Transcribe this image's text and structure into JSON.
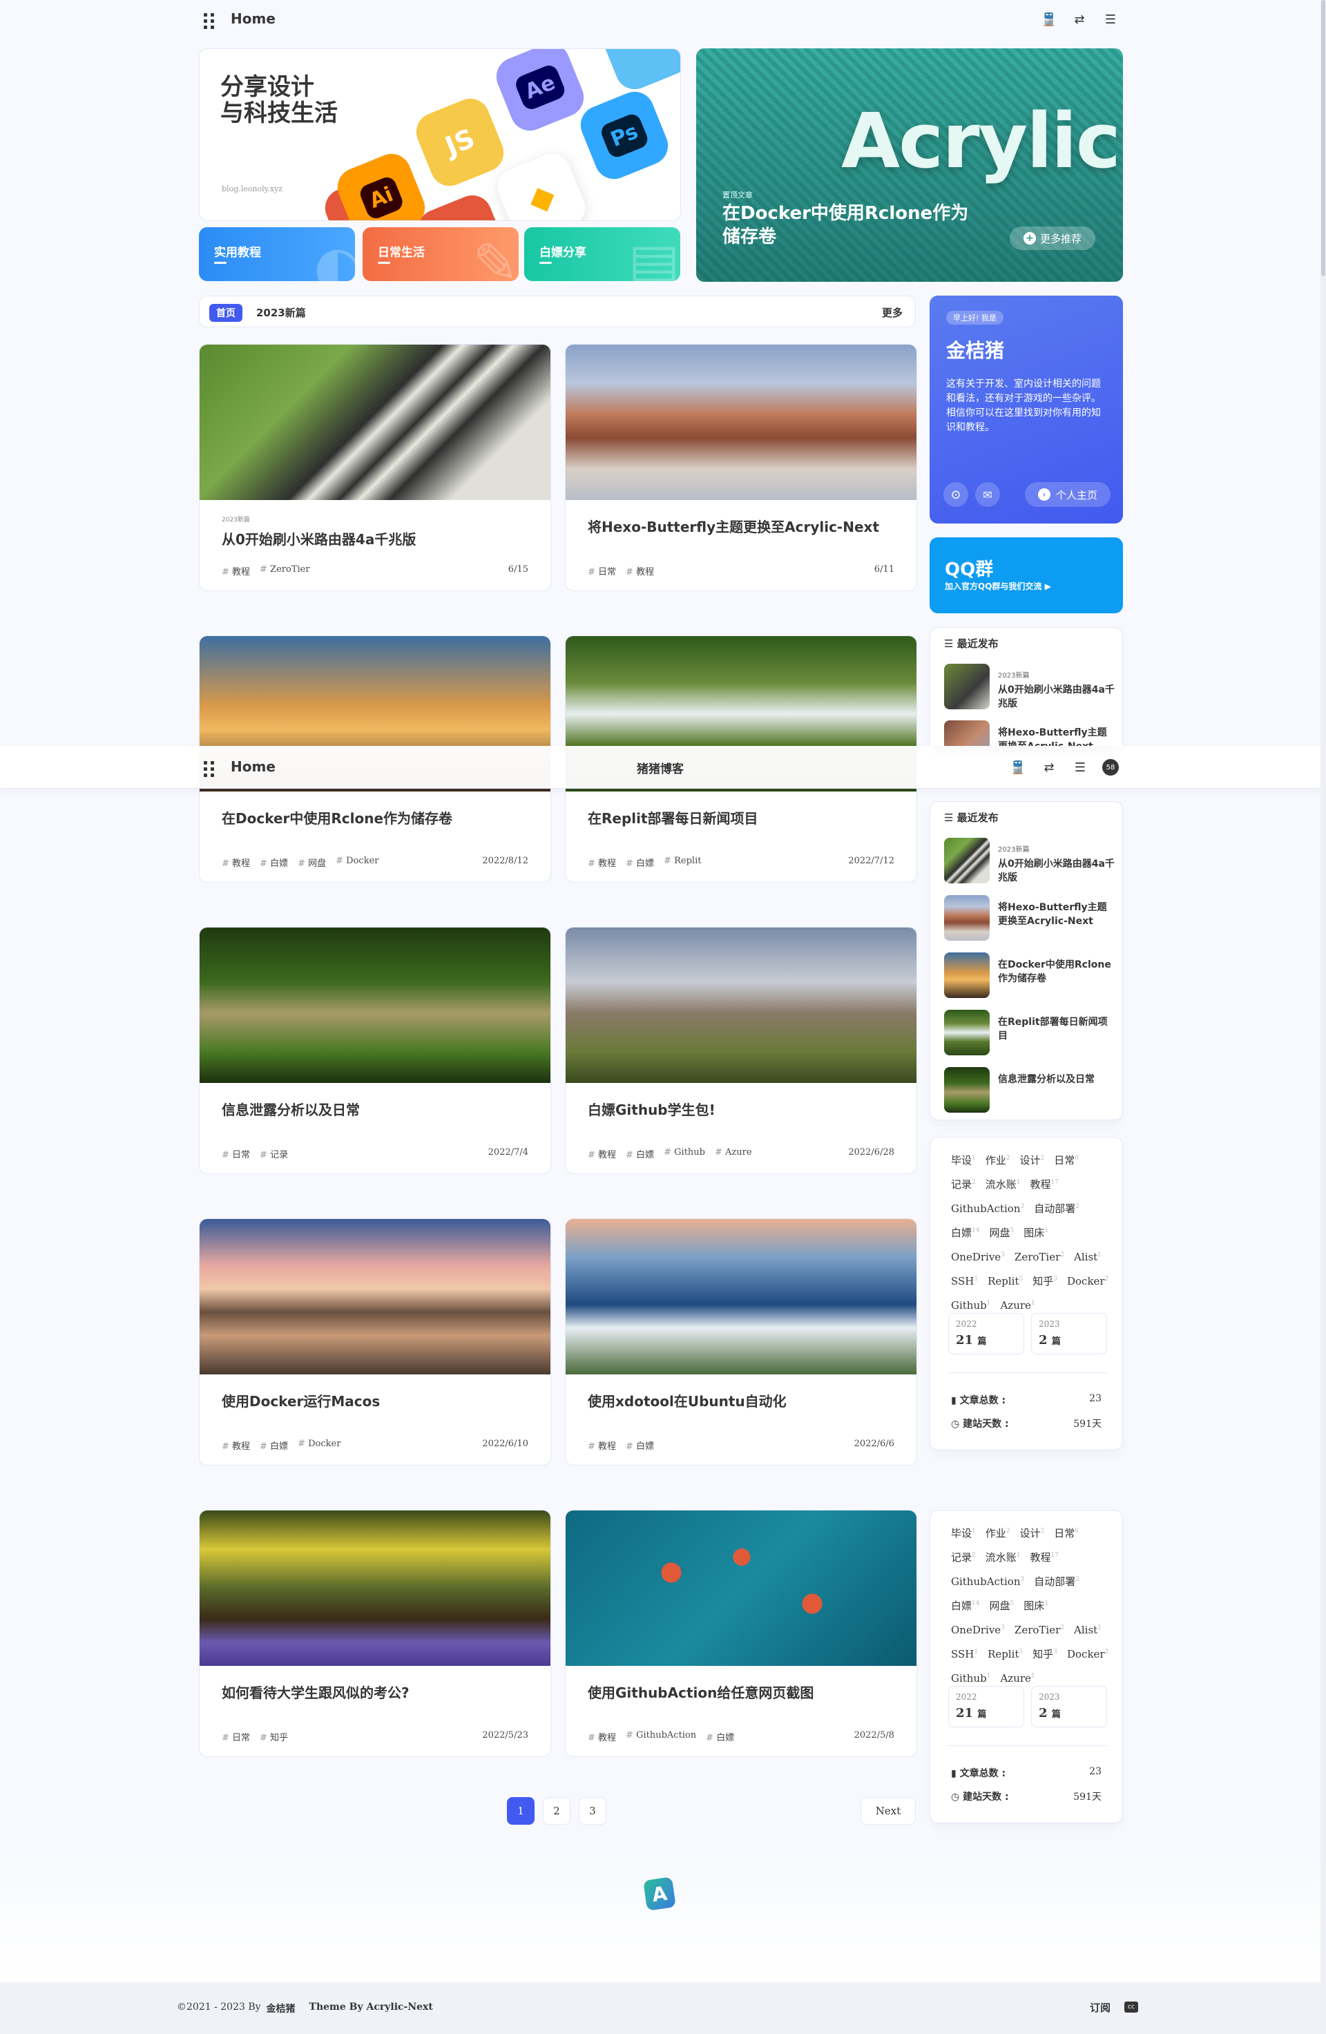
{
  "nav": {
    "home": "Home",
    "blog_name": "猪猪博客",
    "avatar_text": "58"
  },
  "hero": {
    "title_line1": "分享设计",
    "title_line2": "与科技生活",
    "subtitle": "blog.leonoly.xyz",
    "apps": [
      "Ai",
      "JS",
      "Ae",
      "Ps"
    ],
    "categories": [
      "实用教程",
      "日常生活",
      "白嫖分享"
    ],
    "feature_badge": "置顶文章",
    "feature_title": "在Docker中使用Rclone作为储存卷",
    "feature_word": "Acrylic",
    "more_recommend": "更多推荐"
  },
  "bar": {
    "home_tag": "首页",
    "latest": "2023新篇",
    "more": "更多"
  },
  "posts": [
    {
      "badge": "2023新篇",
      "title": "从0开始刷小米路由器4a千兆版",
      "tags": [
        "教程",
        "ZeroTier"
      ],
      "date": "6/15"
    },
    {
      "badge": "",
      "title": "将Hexo-Butterfly主题更换至Acrylic-Next",
      "tags": [
        "日常",
        "教程"
      ],
      "date": "6/11"
    },
    {
      "badge": "",
      "title": "在Docker中使用Rclone作为储存卷",
      "tags": [
        "教程",
        "白嫖",
        "网盘",
        "Docker"
      ],
      "date": "2022/8/12"
    },
    {
      "badge": "",
      "title": "在Replit部署每日新闻项目",
      "tags": [
        "教程",
        "白嫖",
        "Replit"
      ],
      "date": "2022/7/12"
    },
    {
      "badge": "",
      "title": "信息泄露分析以及日常",
      "tags": [
        "日常",
        "记录"
      ],
      "date": "2022/7/4"
    },
    {
      "badge": "",
      "title": "白嫖Github学生包!",
      "tags": [
        "教程",
        "白嫖",
        "Github",
        "Azure"
      ],
      "date": "2022/6/28"
    },
    {
      "badge": "",
      "title": "使用Docker运行Macos",
      "tags": [
        "教程",
        "白嫖",
        "Docker"
      ],
      "date": "2022/6/10"
    },
    {
      "badge": "",
      "title": "使用xdotool在Ubuntu自动化",
      "tags": [
        "教程",
        "白嫖"
      ],
      "date": "2022/6/6"
    },
    {
      "badge": "",
      "title": "如何看待大学生跟风似的考公?",
      "tags": [
        "日常",
        "知乎"
      ],
      "date": "2022/5/23"
    },
    {
      "badge": "",
      "title": "使用GithubAction给任意网页截图",
      "tags": [
        "教程",
        "GithubAction",
        "白嫖"
      ],
      "date": "2022/5/8"
    }
  ],
  "author": {
    "greeting": "早上好! 我是",
    "name": "金桔猪",
    "bio1": "这有关于开发、室内设计相关的问题和看法，还有对于游戏的一些杂评。",
    "bio2": "相信你可以在这里找到对你有用的知识和教程。",
    "home_button": "个人主页"
  },
  "qq": {
    "title": "QQ群",
    "subtitle": "加入官方QQ群与我们交流 ▶"
  },
  "recent": {
    "title": "最近发布",
    "items": [
      {
        "badge": "2023新篇",
        "title": "从0开始刷小米路由器4a千兆版"
      },
      {
        "badge": "",
        "title": "将Hexo-Butterfly主题更换至Acrylic-Next"
      },
      {
        "badge": "",
        "title": "在Docker中使用Rclone作为储存卷"
      },
      {
        "badge": "",
        "title": "在Replit部署每日新闻项目"
      },
      {
        "badge": "",
        "title": "信息泄露分析以及日常"
      }
    ]
  },
  "tags": [
    {
      "name": "毕设",
      "count": "1"
    },
    {
      "name": "作业",
      "count": "2"
    },
    {
      "name": "设计",
      "count": "2"
    },
    {
      "name": "日常",
      "count": "6"
    },
    {
      "name": "记录",
      "count": "2"
    },
    {
      "name": "流水账",
      "count": "1"
    },
    {
      "name": "教程",
      "count": "17"
    },
    {
      "name": "GithubAction",
      "count": "3"
    },
    {
      "name": "自动部署",
      "count": "2"
    },
    {
      "name": "白嫖",
      "count": "14"
    },
    {
      "name": "网盘",
      "count": "5"
    },
    {
      "name": "图床",
      "count": "1"
    },
    {
      "name": "OneDrive",
      "count": "3"
    },
    {
      "name": "ZeroTier",
      "count": "2"
    },
    {
      "name": "Alist",
      "count": "1"
    },
    {
      "name": "SSH",
      "count": "1"
    },
    {
      "name": "Replit",
      "count": "5"
    },
    {
      "name": "知乎",
      "count": "3"
    },
    {
      "name": "Docker",
      "count": "2"
    },
    {
      "name": "Github",
      "count": "1"
    },
    {
      "name": "Azure",
      "count": "1"
    }
  ],
  "archive": [
    {
      "year": "2022",
      "count": "21",
      "unit": "篇"
    },
    {
      "year": "2023",
      "count": "2",
      "unit": "篇"
    }
  ],
  "stats": {
    "posts_label": "文章总数 :",
    "posts_value": "23",
    "days_label": "建站天数 :",
    "days_value": "591天"
  },
  "pagination": {
    "pages": [
      "1",
      "2",
      "3"
    ],
    "next": "Next"
  },
  "footer": {
    "copyright": "©2021 - 2023 By",
    "author": "金桔猪",
    "theme": "Theme By Acrylic-Next",
    "subscribe": "订阅",
    "cc": "cc"
  },
  "colors": {
    "accent": "#425aef",
    "qq": "#0c9cf2",
    "hero_teal": "#2f9d92"
  }
}
